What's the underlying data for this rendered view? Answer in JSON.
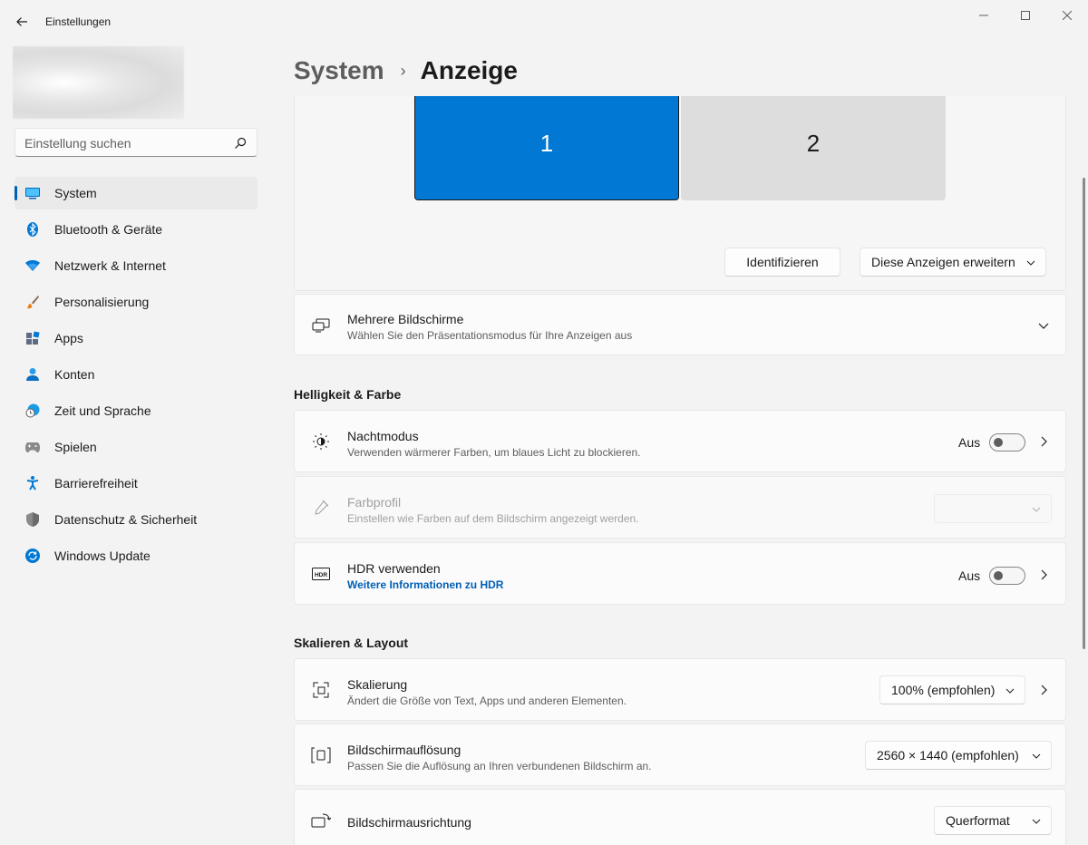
{
  "window": {
    "title": "Einstellungen"
  },
  "search": {
    "placeholder": "Einstellung suchen"
  },
  "sidebar": {
    "items": [
      {
        "label": "System",
        "icon": "system-icon"
      },
      {
        "label": "Bluetooth & Geräte",
        "icon": "bluetooth-icon"
      },
      {
        "label": "Netzwerk & Internet",
        "icon": "wifi-icon"
      },
      {
        "label": "Personalisierung",
        "icon": "brush-icon"
      },
      {
        "label": "Apps",
        "icon": "apps-icon"
      },
      {
        "label": "Konten",
        "icon": "account-icon"
      },
      {
        "label": "Zeit und Sprache",
        "icon": "clock-globe-icon"
      },
      {
        "label": "Spielen",
        "icon": "gamepad-icon"
      },
      {
        "label": "Barrierefreiheit",
        "icon": "accessibility-icon"
      },
      {
        "label": "Datenschutz & Sicherheit",
        "icon": "shield-icon"
      },
      {
        "label": "Windows Update",
        "icon": "update-icon"
      }
    ]
  },
  "breadcrumb": {
    "parent": "System",
    "separator": "›",
    "current": "Anzeige"
  },
  "displays": {
    "monitor_1": "1",
    "monitor_2": "2",
    "identify_label": "Identifizieren",
    "extend_label": "Diese Anzeigen erweitern"
  },
  "multiple_displays": {
    "title": "Mehrere Bildschirme",
    "subtitle": "Wählen Sie den Präsentationsmodus für Ihre Anzeigen aus"
  },
  "brightness_section": {
    "title": "Helligkeit & Farbe",
    "night_mode": {
      "title": "Nachtmodus",
      "subtitle": "Verwenden wärmerer Farben, um blaues Licht zu blockieren.",
      "state": "Aus"
    },
    "color_profile": {
      "title": "Farbprofil",
      "subtitle": "Einstellen wie Farben auf dem Bildschirm angezeigt werden."
    },
    "hdr": {
      "title": "HDR verwenden",
      "link": "Weitere Informationen zu HDR",
      "state": "Aus"
    }
  },
  "layout_section": {
    "title": "Skalieren & Layout",
    "scale": {
      "title": "Skalierung",
      "subtitle": "Ändert die Größe von Text, Apps und anderen Elementen.",
      "value": "100% (empfohlen)"
    },
    "resolution": {
      "title": "Bildschirmauflösung",
      "subtitle": "Passen Sie die Auflösung an Ihren verbundenen Bildschirm an.",
      "value": "2560 × 1440 (empfohlen)"
    },
    "orientation": {
      "title": "Bildschirmausrichtung",
      "value": "Querformat"
    }
  },
  "colors": {
    "accent": "#0078d4",
    "link": "#005fb8",
    "background": "#f3f3f3"
  }
}
